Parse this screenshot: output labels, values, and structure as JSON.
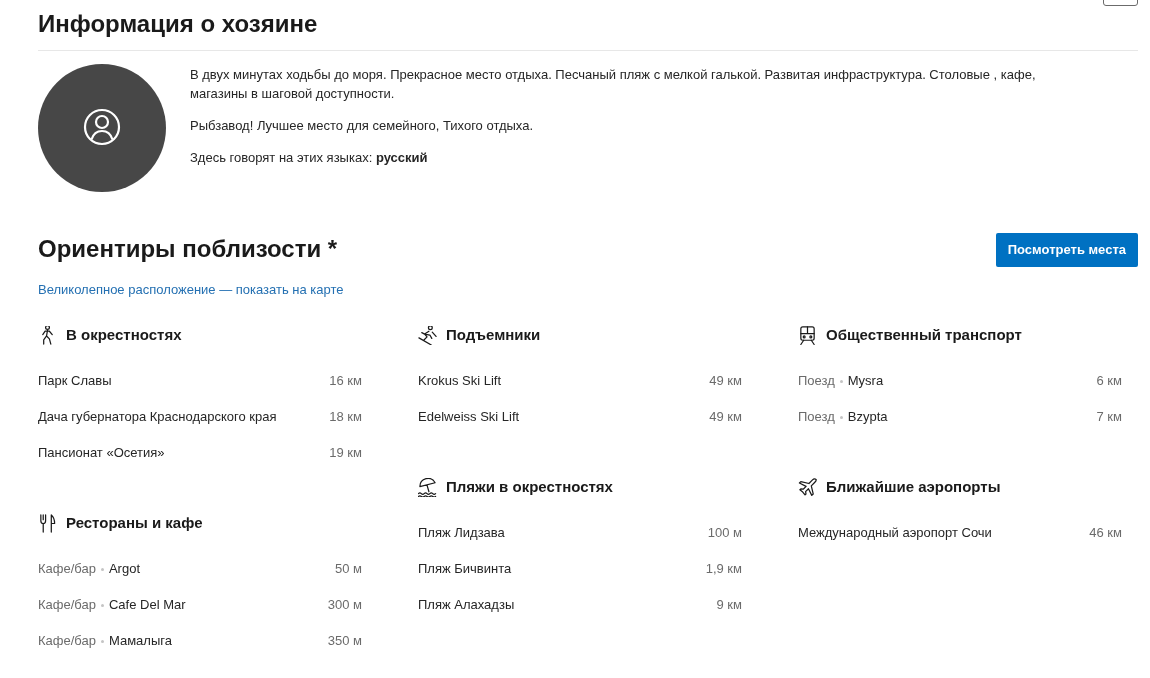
{
  "host_info": {
    "title": "Информация о хозяине",
    "paragraphs": [
      "В двух минутах ходьбы до моря. Прекрасное место отдыха. Песчаный пляж с мелкой галькой. Развитая инфраструктура. Столовые , кафе, магазины в шаговой доступности.",
      "Рыбзавод! Лучшее место для семейного, Тихого отдыха."
    ],
    "languages": "Здесь говорят на этих языках: **русский**"
  },
  "nearby": {
    "title": "Ориентиры поблизости *",
    "button": "Посмотреть места",
    "map_link": "Великолепное расположение — показать на карте",
    "columns": [
      [
        {
          "kind": "walk",
          "title": "В окрестностях",
          "places": [
            {
              "name": "Парк Славы",
              "distance": "16 км"
            },
            {
              "name": "Дача губернатора Краснодарского края",
              "distance": "18 км"
            },
            {
              "name": "Пансионат «Осетия»",
              "distance": "19 км"
            }
          ]
        },
        {
          "kind": "restaurant",
          "title": "Рестораны и кафе",
          "places": [
            {
              "type": "Кафе/бар",
              "name": "Argot",
              "distance": "50 м"
            },
            {
              "type": "Кафе/бар",
              "name": "Cafe Del Mar",
              "distance": "300 м"
            },
            {
              "type": "Кафе/бар",
              "name": "Мамалыга",
              "distance": "350 м"
            }
          ]
        }
      ],
      [
        {
          "kind": "ski",
          "title": "Подъемники",
          "places": [
            {
              "name": "Krokus Ski Lift",
              "distance": "49 км"
            },
            {
              "name": "Edelweiss Ski Lift",
              "distance": "49 км"
            }
          ]
        },
        {
          "kind": "beach",
          "title": "Пляжи в окрестностях",
          "places": [
            {
              "name": "Пляж Лидзава",
              "distance": "100 м"
            },
            {
              "name": "Пляж Бичвинта",
              "distance": "1,9 км"
            },
            {
              "name": "Пляж Алахадзы",
              "distance": "9 км"
            }
          ]
        }
      ],
      [
        {
          "kind": "train",
          "title": "Общественный транспорт",
          "places": [
            {
              "type": "Поезд",
              "name": "Mysra",
              "distance": "6 км"
            },
            {
              "type": "Поезд",
              "name": "Bzypta",
              "distance": "7 км"
            }
          ]
        },
        {
          "kind": "airport",
          "title": "Ближайшие аэропорты",
          "places": [
            {
              "name": "Международный аэропорт Сочи",
              "distance": "46 км"
            }
          ]
        }
      ]
    ]
  }
}
